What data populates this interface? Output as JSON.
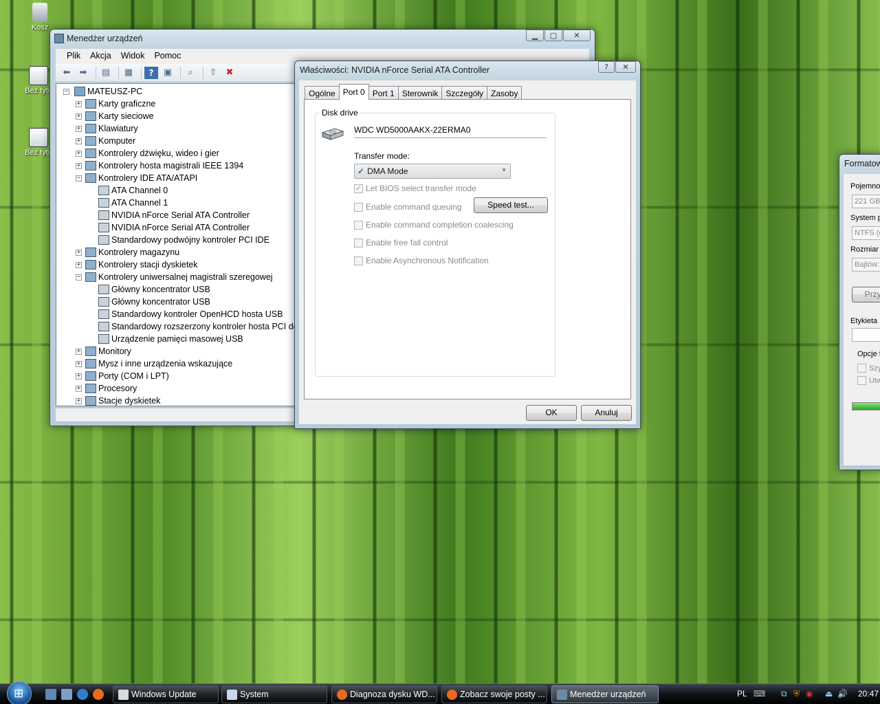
{
  "desktop": {
    "icons": [
      {
        "label": "Kosz"
      },
      {
        "label": "Bez tytu"
      },
      {
        "label": "Bez tytu"
      }
    ]
  },
  "device_manager": {
    "title": "Menedżer urządzeń",
    "menu": [
      "Plik",
      "Akcja",
      "Widok",
      "Pomoc"
    ],
    "tree": {
      "root": "MATEUSZ-PC",
      "items": [
        {
          "label": "Karty graficzne",
          "level": 1,
          "expander": "+"
        },
        {
          "label": "Karty sieciowe",
          "level": 1,
          "expander": "+"
        },
        {
          "label": "Klawiatury",
          "level": 1,
          "expander": "+"
        },
        {
          "label": "Komputer",
          "level": 1,
          "expander": "+"
        },
        {
          "label": "Kontrolery dźwięku, wideo i gier",
          "level": 1,
          "expander": "+"
        },
        {
          "label": "Kontrolery hosta magistrali IEEE 1394",
          "level": 1,
          "expander": "+"
        },
        {
          "label": "Kontrolery IDE ATA/ATAPI",
          "level": 1,
          "expander": "-"
        },
        {
          "label": "ATA Channel 0",
          "level": 2
        },
        {
          "label": "ATA Channel 1",
          "level": 2
        },
        {
          "label": "NVIDIA nForce Serial ATA Controller",
          "level": 2
        },
        {
          "label": "NVIDIA nForce Serial ATA Controller",
          "level": 2
        },
        {
          "label": "Standardowy podwójny kontroler PCI IDE",
          "level": 2
        },
        {
          "label": "Kontrolery magazynu",
          "level": 1,
          "expander": "+"
        },
        {
          "label": "Kontrolery stacji dyskietek",
          "level": 1,
          "expander": "+"
        },
        {
          "label": "Kontrolery uniwersalnej magistrali szeregowej",
          "level": 1,
          "expander": "-"
        },
        {
          "label": "Główny koncentrator USB",
          "level": 2
        },
        {
          "label": "Główny koncentrator USB",
          "level": 2
        },
        {
          "label": "Standardowy kontroler OpenHCD hosta USB",
          "level": 2
        },
        {
          "label": "Standardowy rozszerzony kontroler hosta PCI do U",
          "level": 2
        },
        {
          "label": "Urządzenie pamięci masowej USB",
          "level": 2
        },
        {
          "label": "Monitory",
          "level": 1,
          "expander": "+"
        },
        {
          "label": "Mysz i inne urządzenia wskazujące",
          "level": 1,
          "expander": "+"
        },
        {
          "label": "Porty (COM i LPT)",
          "level": 1,
          "expander": "+"
        },
        {
          "label": "Procesory",
          "level": 1,
          "expander": "+"
        },
        {
          "label": "Stacje dyskietek",
          "level": 1,
          "expander": "+"
        }
      ]
    }
  },
  "properties": {
    "title": "Właściwości: NVIDIA nForce Serial ATA Controller",
    "help_glyph": "?",
    "close_glyph": "✕",
    "tabs": [
      "Ogólne",
      "Port 0",
      "Port 1",
      "Sterownik",
      "Szczegóły",
      "Zasoby"
    ],
    "active_tab": "Port 0",
    "group_label": "Disk drive",
    "disk_name": "WDC WD5000AAKX-22ERMA0",
    "transfer_mode_label": "Transfer mode:",
    "transfer_mode_value": "DMA Mode",
    "checkboxes": [
      {
        "label": "Let BIOS select transfer mode",
        "checked": true
      },
      {
        "label": "Enable command queuing",
        "checked": false
      },
      {
        "label": "Enable command completion coalescing",
        "checked": false
      },
      {
        "label": "Enable free fall control",
        "checked": false
      },
      {
        "label": "Enable Asynchronous Notification",
        "checked": false
      }
    ],
    "speed_test_label": "Speed test...",
    "ok_label": "OK",
    "cancel_label": "Anuluj"
  },
  "format_window": {
    "title": "Formatow",
    "capacity_label": "Pojemnoś",
    "capacity_value": "221 GB",
    "filesystem_label": "System p",
    "filesystem_value": "NTFS (d",
    "size_label": "Rozmiar j",
    "size_value": "Bajtów:",
    "restore_button": "Przyw",
    "volume_label": "Etykieta",
    "options_label": "Opcje f",
    "option1": "Szyb",
    "option2": "Utw"
  },
  "taskbar": {
    "buttons": [
      {
        "label": "Windows Update",
        "active": false
      },
      {
        "label": "System",
        "active": false
      },
      {
        "label": "Diagnoza dysku WD...",
        "active": false
      },
      {
        "label": "Zobacz swoje posty ...",
        "active": false
      },
      {
        "label": "Menedżer urządzeń",
        "active": true
      }
    ],
    "language": "PL",
    "clock": "20:47"
  }
}
